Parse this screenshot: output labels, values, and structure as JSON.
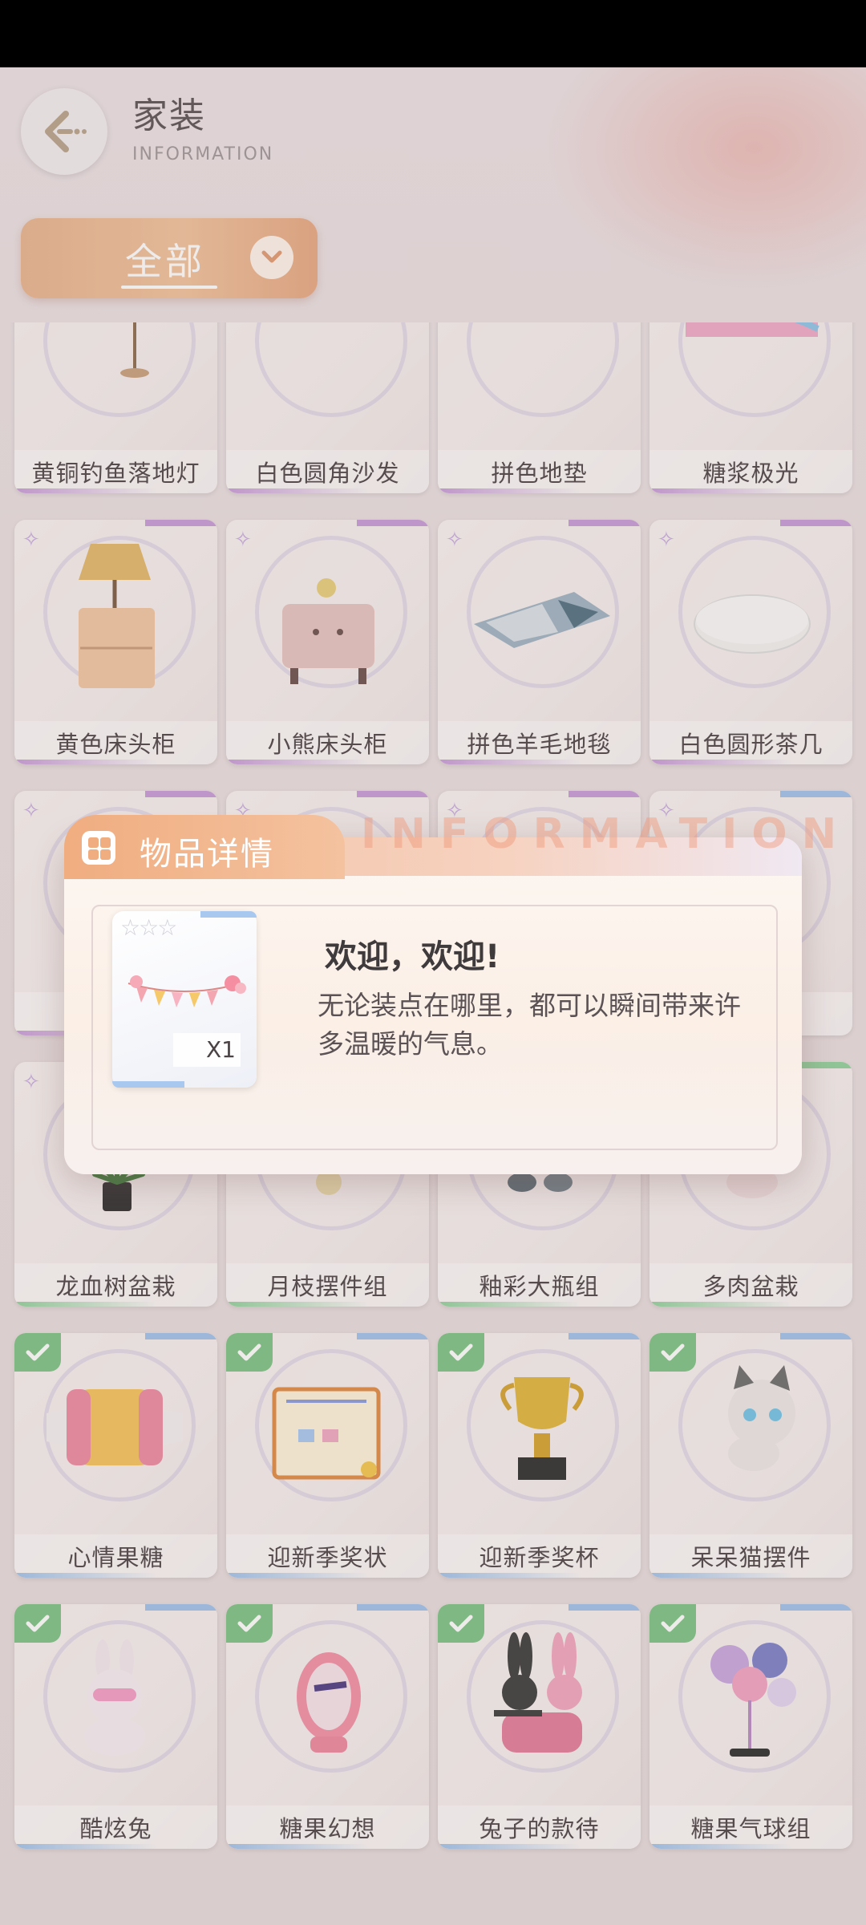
{
  "header": {
    "title": "家装",
    "subtitle": "INFORMATION"
  },
  "filter": {
    "label": "全部"
  },
  "colors": {
    "accent": "#f0ad80",
    "owned": "#7dc383",
    "rarity_purple": "#c79ad8",
    "rarity_blue": "#9ec2ea",
    "rarity_green": "#8fd19a"
  },
  "items": [
    {
      "name": "黄铜钓鱼落地灯",
      "owned": false
    },
    {
      "name": "白色圆角沙发",
      "owned": false
    },
    {
      "name": "拼色地垫",
      "owned": false
    },
    {
      "name": "糖浆极光",
      "owned": false
    },
    {
      "name": "黄色床头柜",
      "owned": false
    },
    {
      "name": "小熊床头柜",
      "owned": false
    },
    {
      "name": "拼色羊毛地毯",
      "owned": false
    },
    {
      "name": "白色圆形茶几",
      "owned": false
    },
    {
      "name": "",
      "owned": false
    },
    {
      "name": "",
      "owned": false
    },
    {
      "name": "",
      "owned": false
    },
    {
      "name": "!",
      "owned": false
    },
    {
      "name": "龙血树盆栽",
      "owned": false
    },
    {
      "name": "月枝摆件组",
      "owned": false
    },
    {
      "name": "釉彩大瓶组",
      "owned": false
    },
    {
      "name": "多肉盆栽",
      "owned": false
    },
    {
      "name": "心情果糖",
      "owned": true
    },
    {
      "name": "迎新季奖状",
      "owned": true
    },
    {
      "name": "迎新季奖杯",
      "owned": true
    },
    {
      "name": "呆呆猫摆件",
      "owned": true
    },
    {
      "name": "酷炫兔",
      "owned": true
    },
    {
      "name": "糖果幻想",
      "owned": true
    },
    {
      "name": "兔子的款待",
      "owned": true
    },
    {
      "name": "糖果气球组",
      "owned": true
    }
  ],
  "dialog": {
    "title": "物品详情",
    "watermark": "INFORMATION",
    "item": {
      "rarity_stars": "☆☆☆",
      "count": "X1",
      "name": "欢迎，欢迎!",
      "description": "无论装点在哪里，都可以瞬间带来许多温暖的气息。"
    }
  }
}
